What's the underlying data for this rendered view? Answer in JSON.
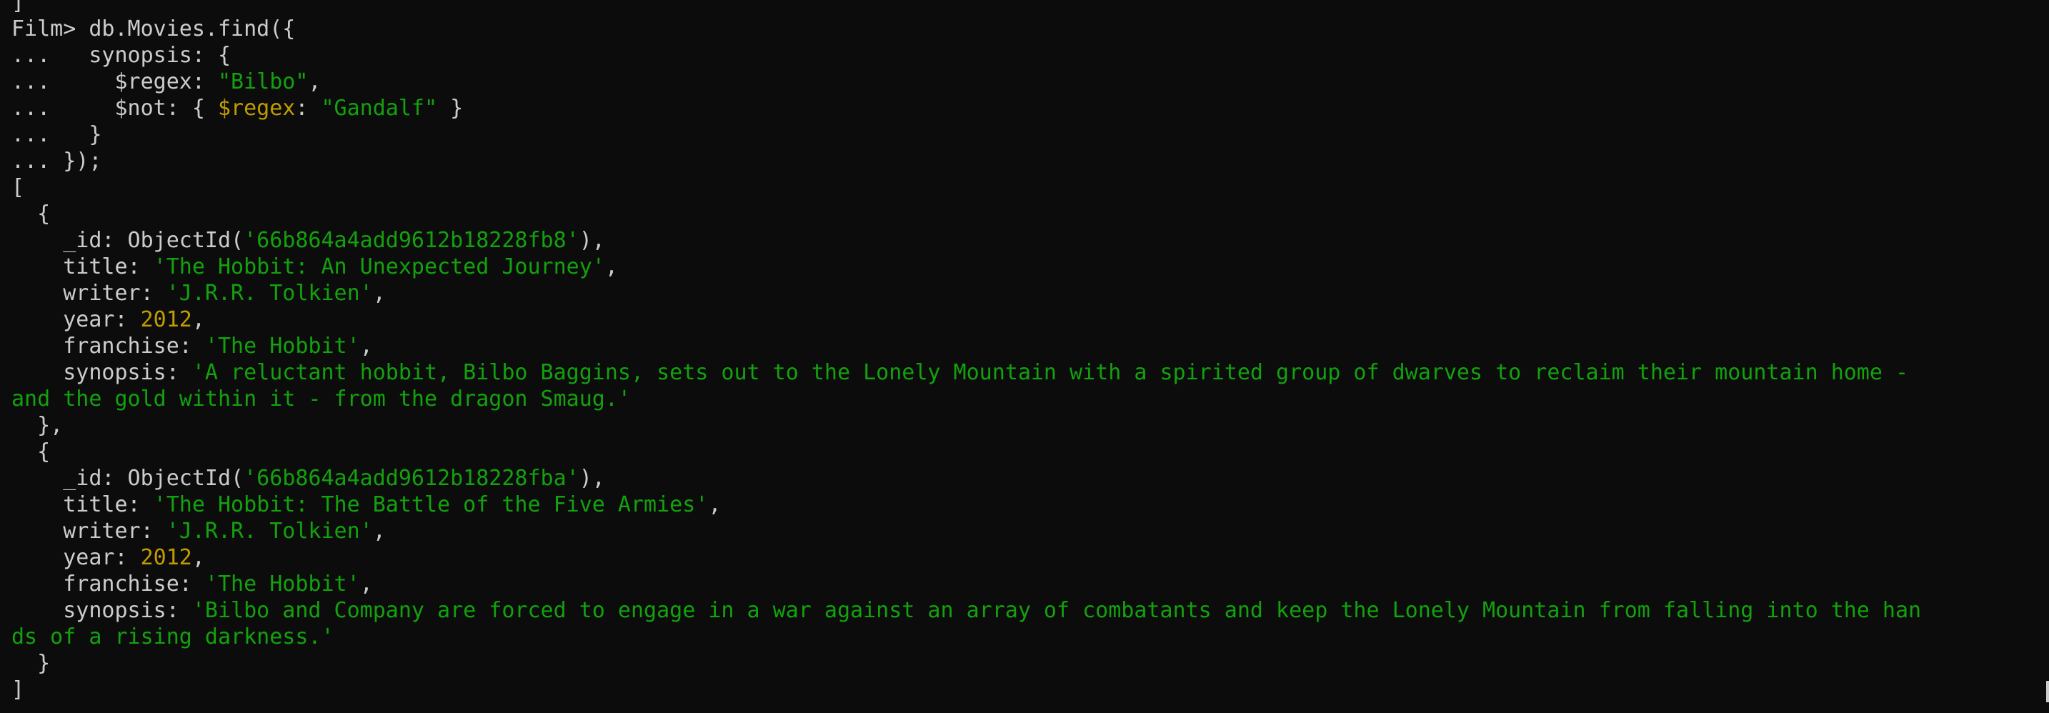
{
  "colors": {
    "background": "#0c0c0c",
    "text": "#cccccc",
    "string": "#13a10e",
    "number": "#c19c00"
  },
  "lines": [
    [
      {
        "t": "]",
        "c": "plain"
      }
    ],
    [
      {
        "t": "Film> db.Movies.find({",
        "c": "plain"
      }
    ],
    [
      {
        "t": "...   synopsis: {",
        "c": "plain"
      }
    ],
    [
      {
        "t": "...     $regex: ",
        "c": "plain"
      },
      {
        "t": "\"Bilbo\"",
        "c": "str"
      },
      {
        "t": ",",
        "c": "plain"
      }
    ],
    [
      {
        "t": "...     $not: { ",
        "c": "plain"
      },
      {
        "t": "$regex",
        "c": "kw"
      },
      {
        "t": ": ",
        "c": "plain"
      },
      {
        "t": "\"Gandalf\"",
        "c": "str"
      },
      {
        "t": " }",
        "c": "plain"
      }
    ],
    [
      {
        "t": "...   }",
        "c": "plain"
      }
    ],
    [
      {
        "t": "... });",
        "c": "plain"
      }
    ],
    [
      {
        "t": "[",
        "c": "plain"
      }
    ],
    [
      {
        "t": "  {",
        "c": "plain"
      }
    ],
    [
      {
        "t": "    _id: ObjectId(",
        "c": "plain"
      },
      {
        "t": "'66b864a4add9612b18228fb8'",
        "c": "str"
      },
      {
        "t": "),",
        "c": "plain"
      }
    ],
    [
      {
        "t": "    title: ",
        "c": "plain"
      },
      {
        "t": "'The Hobbit: An Unexpected Journey'",
        "c": "str"
      },
      {
        "t": ",",
        "c": "plain"
      }
    ],
    [
      {
        "t": "    writer: ",
        "c": "plain"
      },
      {
        "t": "'J.R.R. Tolkien'",
        "c": "str"
      },
      {
        "t": ",",
        "c": "plain"
      }
    ],
    [
      {
        "t": "    year: ",
        "c": "plain"
      },
      {
        "t": "2012",
        "c": "num"
      },
      {
        "t": ",",
        "c": "plain"
      }
    ],
    [
      {
        "t": "    franchise: ",
        "c": "plain"
      },
      {
        "t": "'The Hobbit'",
        "c": "str"
      },
      {
        "t": ",",
        "c": "plain"
      }
    ],
    [
      {
        "t": "    synopsis: ",
        "c": "plain"
      },
      {
        "t": "'A reluctant hobbit, Bilbo Baggins, sets out to the Lonely Mountain with a spirited group of dwarves to reclaim their mountain home -",
        "c": "str"
      }
    ],
    [
      {
        "t": "and the gold within it - from the dragon Smaug.'",
        "c": "str"
      }
    ],
    [
      {
        "t": "  },",
        "c": "plain"
      }
    ],
    [
      {
        "t": "  {",
        "c": "plain"
      }
    ],
    [
      {
        "t": "    _id: ObjectId(",
        "c": "plain"
      },
      {
        "t": "'66b864a4add9612b18228fba'",
        "c": "str"
      },
      {
        "t": "),",
        "c": "plain"
      }
    ],
    [
      {
        "t": "    title: ",
        "c": "plain"
      },
      {
        "t": "'The Hobbit: The Battle of the Five Armies'",
        "c": "str"
      },
      {
        "t": ",",
        "c": "plain"
      }
    ],
    [
      {
        "t": "    writer: ",
        "c": "plain"
      },
      {
        "t": "'J.R.R. Tolkien'",
        "c": "str"
      },
      {
        "t": ",",
        "c": "plain"
      }
    ],
    [
      {
        "t": "    year: ",
        "c": "plain"
      },
      {
        "t": "2012",
        "c": "num"
      },
      {
        "t": ",",
        "c": "plain"
      }
    ],
    [
      {
        "t": "    franchise: ",
        "c": "plain"
      },
      {
        "t": "'The Hobbit'",
        "c": "str"
      },
      {
        "t": ",",
        "c": "plain"
      }
    ],
    [
      {
        "t": "    synopsis: ",
        "c": "plain"
      },
      {
        "t": "'Bilbo and Company are forced to engage in a war against an array of combatants and keep the Lonely Mountain from falling into the han",
        "c": "str"
      }
    ],
    [
      {
        "t": "ds of a rising darkness.'",
        "c": "str"
      }
    ],
    [
      {
        "t": "  }",
        "c": "plain"
      }
    ],
    [
      {
        "t": "]",
        "c": "plain"
      }
    ]
  ]
}
